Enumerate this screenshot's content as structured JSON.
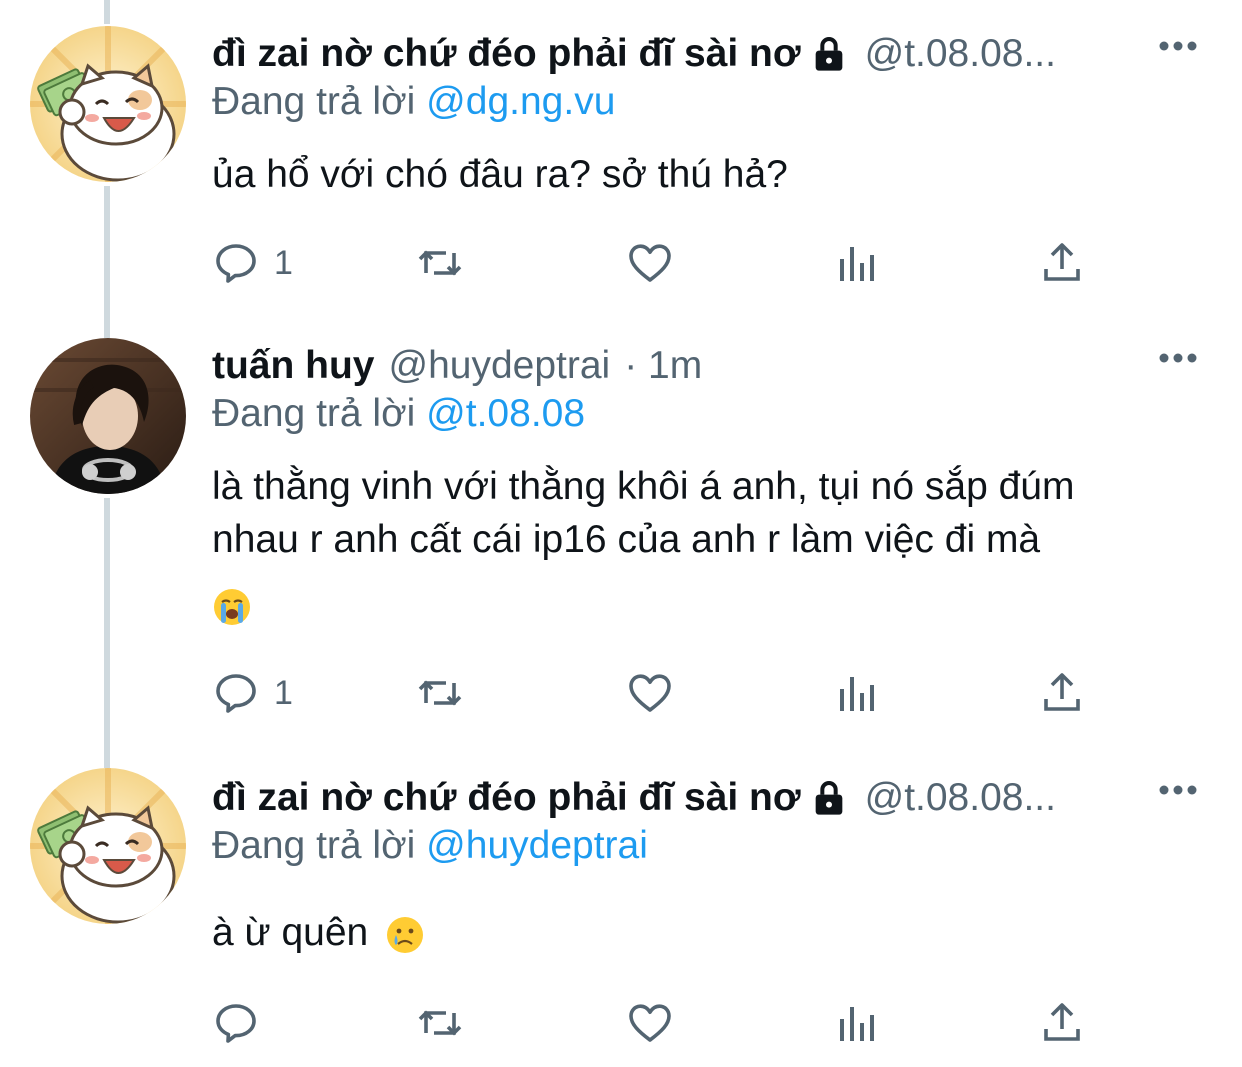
{
  "tweets": [
    {
      "display_name": "đì zai nờ chứ đéo phải đĩ sài nơ",
      "handle": "@t.08.08...",
      "time": "",
      "protected": true,
      "reply_prefix": "Đang trả lời",
      "reply_to": "@dg.ng.vu",
      "text_lines": [
        "ủa hổ với chó đâu ra? sở thú hả?"
      ],
      "reply_count": "1",
      "avatar": "cartoon-cat-money-avatar"
    },
    {
      "display_name": "tuấn huy",
      "handle": "@huydeptrai",
      "time": "· 1m",
      "protected": false,
      "reply_prefix": "Đang trả lời",
      "reply_to": "@t.08.08",
      "text_lines": [
        "là thằng vinh với thằng khôi á anh, tụi nó sắp đúm",
        "nhau r anh cất cái ip16 của anh r làm việc đi mà"
      ],
      "emoji": "loudly-crying-face",
      "reply_count": "1",
      "avatar": "person-photo-avatar"
    },
    {
      "display_name": "đì zai nờ chứ đéo phải đĩ sài nơ",
      "handle": "@t.08.08...",
      "time": "",
      "protected": true,
      "reply_prefix": "Đang trả lời",
      "reply_to": "@huydeptrai",
      "text_lines": [
        "à ừ quên"
      ],
      "emoji": "crying-face",
      "reply_count": "",
      "avatar": "cartoon-cat-money-avatar"
    }
  ],
  "colors": {
    "text_primary": "#0f1419",
    "text_secondary": "#536471",
    "mention": "#1d9bf0",
    "thread_line": "#cfd9de"
  }
}
